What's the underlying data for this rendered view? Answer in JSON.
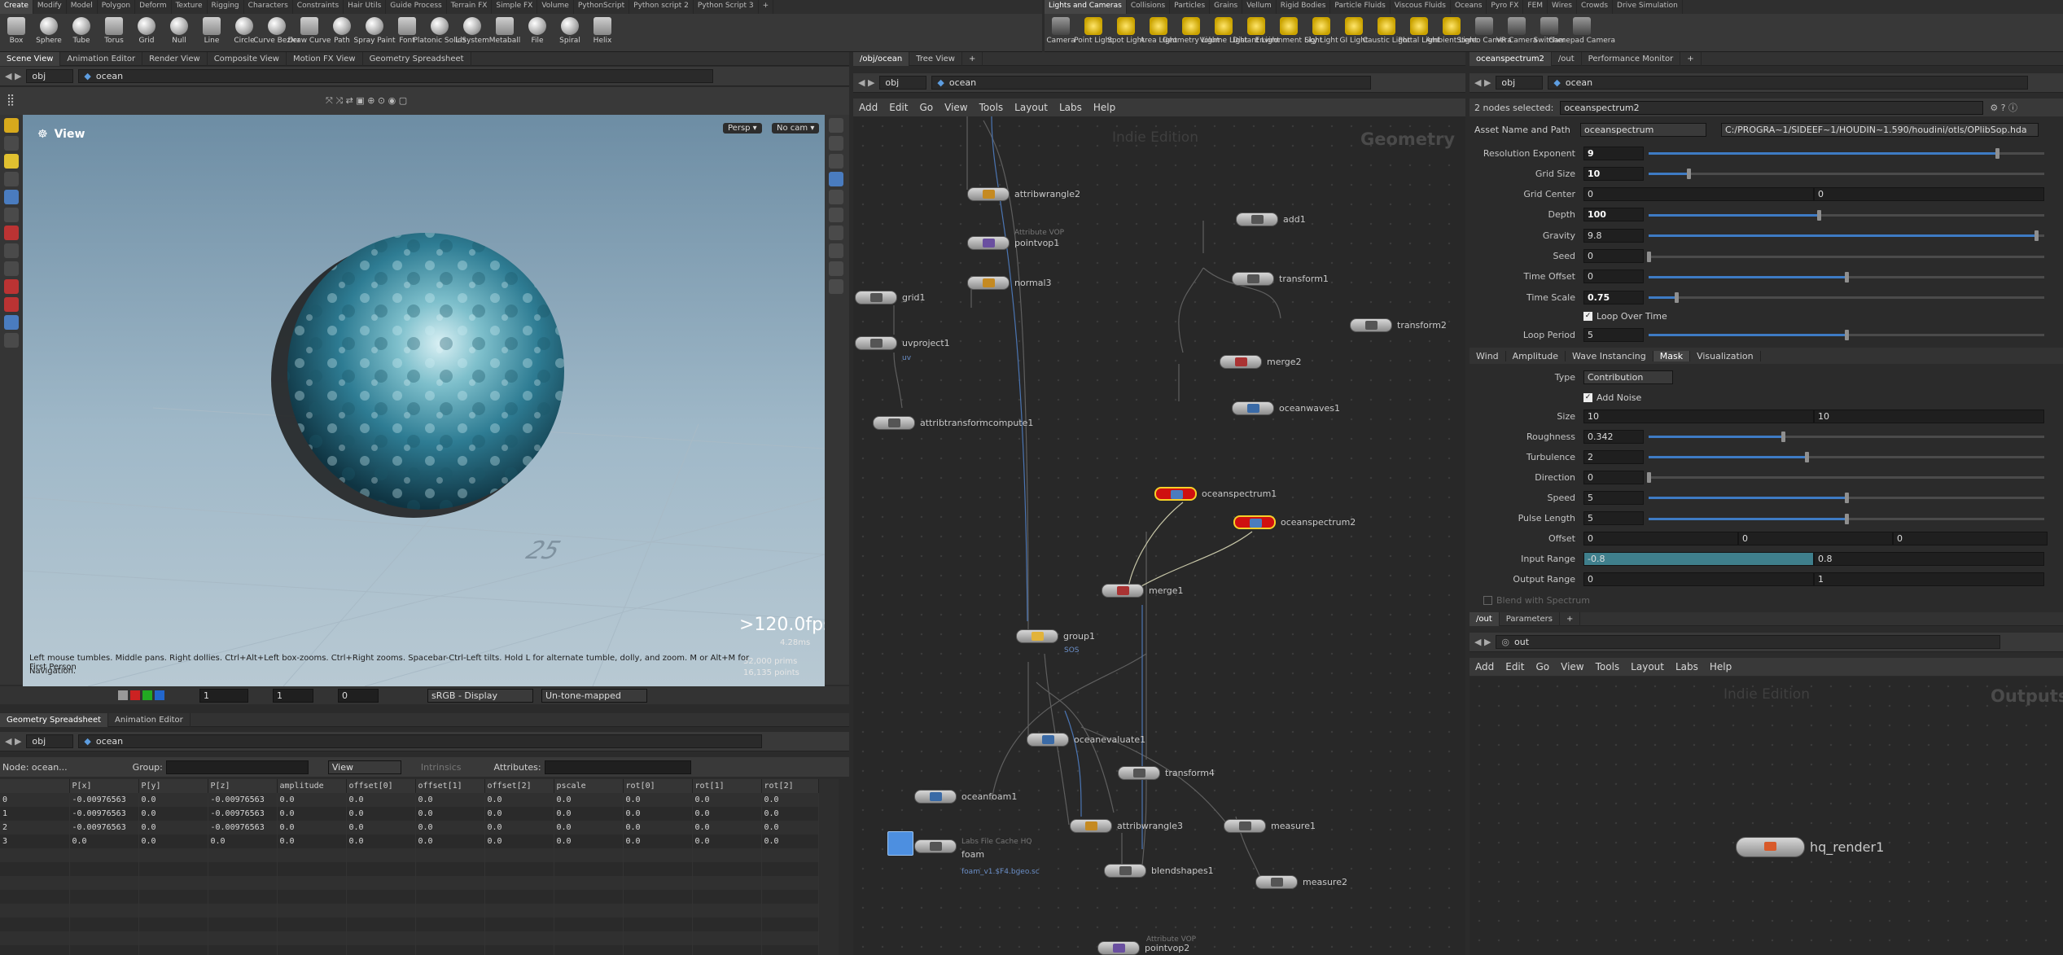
{
  "shelf_left": {
    "tabs": [
      "Create",
      "Modify",
      "Model",
      "Polygon",
      "Deform",
      "Texture",
      "Rigging",
      "Characters",
      "Constraints",
      "Hair Utils",
      "Guide Process",
      "Terrain FX",
      "Simple FX",
      "Volume",
      "PythonScript",
      "Python script 2",
      "Python Script 3",
      "+"
    ],
    "tools": [
      "Box",
      "Sphere",
      "Tube",
      "Torus",
      "Grid",
      "Null",
      "Line",
      "Circle",
      "Curve Bezier",
      "Draw Curve",
      "Path",
      "Spray Paint",
      "Font",
      "Platonic Solids",
      "L-System",
      "Metaball",
      "File",
      "Spiral",
      "Helix"
    ]
  },
  "shelf_right": {
    "tabs": [
      "Lights and Cameras",
      "Collisions",
      "Particles",
      "Grains",
      "Vellum",
      "Rigid Bodies",
      "Particle Fluids",
      "Viscous Fluids",
      "Oceans",
      "Pyro FX",
      "FEM",
      "Wires",
      "Crowds",
      "Drive Simulation"
    ],
    "tools": [
      "Camera",
      "Point Light",
      "Spot Light",
      "Area Light",
      "Geometry Light",
      "Volume Light",
      "Distant Light",
      "Environment Light",
      "Sky Light",
      "GI Light",
      "Caustic Light",
      "Portal Light",
      "Ambient Light",
      "Stereo Camera",
      "VR Camera",
      "Switcher",
      "Gamepad Camera"
    ]
  },
  "viewer": {
    "tabs": [
      "Scene View",
      "Animation Editor",
      "Render View",
      "Composite View",
      "Motion FX View",
      "Geometry Spreadsheet"
    ],
    "path": [
      "obj",
      "ocean"
    ],
    "title": "View",
    "persp": "Persp ▾",
    "cam": "No cam ▾",
    "fps": ">120.0fps",
    "ms": "4.28ms",
    "prims": "32,000  prims",
    "points": "16,135  points",
    "grid_number": "25",
    "help": "Left mouse tumbles. Middle pans. Right dollies. Ctrl+Alt+Left box-zooms. Ctrl+Right zooms. Spacebar-Ctrl-Left tilts. Hold L for alternate tumble, dolly, and zoom. M or Alt+M for First Person",
    "help2": "Navigation.",
    "bottom": {
      "frame1": "1",
      "frame2": "1",
      "frame3": "0",
      "display": "sRGB - Display",
      "tonemap": "Un-tone-mapped"
    }
  },
  "spreadsheet": {
    "tabs": [
      "Geometry Spreadsheet",
      "Animation Editor"
    ],
    "path": [
      "obj",
      "ocean"
    ],
    "node": "Node: ocean...",
    "group_label": "Group:",
    "view": "View",
    "intrinsics": "Intrinsics",
    "attributes_label": "Attributes:",
    "columns": [
      "",
      "P[x]",
      "P[y]",
      "P[z]",
      "amplitude",
      "offset[0]",
      "offset[1]",
      "offset[2]",
      "pscale",
      "rot[0]",
      "rot[1]",
      "rot[2]"
    ],
    "rows": [
      [
        "0",
        "-0.00976563",
        "0.0",
        "-0.00976563",
        "0.0",
        "0.0",
        "0.0",
        "0.0",
        "0.0",
        "0.0",
        "0.0",
        "0.0"
      ],
      [
        "1",
        "-0.00976563",
        "0.0",
        "-0.00976563",
        "0.0",
        "0.0",
        "0.0",
        "0.0",
        "0.0",
        "0.0",
        "0.0",
        "0.0"
      ],
      [
        "2",
        "-0.00976563",
        "0.0",
        "-0.00976563",
        "0.0",
        "0.0",
        "0.0",
        "0.0",
        "0.0",
        "0.0",
        "0.0",
        "0.0"
      ],
      [
        "3",
        "0.0",
        "0.0",
        "0.0",
        "0.0",
        "0.0",
        "0.0",
        "0.0",
        "0.0",
        "0.0",
        "0.0",
        "0.0"
      ]
    ]
  },
  "network": {
    "tabs": [
      "/obj/ocean",
      "Tree View",
      "+"
    ],
    "path": [
      "obj",
      "ocean"
    ],
    "menu": [
      "Add",
      "Edit",
      "Go",
      "View",
      "Tools",
      "Layout",
      "Labs",
      "Help"
    ],
    "watermark": "Indie Edition",
    "context": "Geometry",
    "nodes": [
      {
        "name": "attribwrangle2",
        "sub": ""
      },
      {
        "name": "pointvop1",
        "sub": "Attribute VOP"
      },
      {
        "name": "normal3",
        "sub": ""
      },
      {
        "name": "grid1",
        "sub": ""
      },
      {
        "name": "uvproject1",
        "sub": "uv"
      },
      {
        "name": "attribtransformcompute1",
        "sub": ""
      },
      {
        "name": "add1",
        "sub": ""
      },
      {
        "name": "transform1",
        "sub": ""
      },
      {
        "name": "transform2",
        "sub": ""
      },
      {
        "name": "merge2",
        "sub": ""
      },
      {
        "name": "oceanwaves1",
        "sub": ""
      },
      {
        "name": "oceanspectrum1",
        "sub": ""
      },
      {
        "name": "oceanspectrum2",
        "sub": ""
      },
      {
        "name": "merge1",
        "sub": ""
      },
      {
        "name": "group1",
        "sub": "SOS"
      },
      {
        "name": "oceanevaluate1",
        "sub": ""
      },
      {
        "name": "transform4",
        "sub": ""
      },
      {
        "name": "oceanfoam1",
        "sub": ""
      },
      {
        "name": "foam",
        "sub": "Labs File Cache HQ"
      },
      {
        "name": "attribwrangle3",
        "sub": ""
      },
      {
        "name": "measure1",
        "sub": ""
      },
      {
        "name": "blendshapes1",
        "sub": ""
      },
      {
        "name": "measure2",
        "sub": ""
      },
      {
        "name": "pointvop2",
        "sub": "Attribute VOP"
      }
    ],
    "foam_file": "foam_v1.$F4.bgeo.sc"
  },
  "params": {
    "tabs": [
      "oceanspectrum2",
      "/out",
      "Performance Monitor",
      "+"
    ],
    "path": [
      "obj",
      "ocean"
    ],
    "selected_label": "2 nodes selected:",
    "selected_value": "oceanspectrum2",
    "asset_label": "Asset Name and Path",
    "asset_name": "oceanspectrum",
    "asset_path": "C:/PROGRA~1/SIDEEF~1/HOUDIN~1.590/houdini/otls/OPlibSop.hda",
    "top": [
      {
        "label": "Resolution Exponent",
        "value": "9",
        "bold": true,
        "pct": 0.88
      },
      {
        "label": "Grid Size",
        "value": "10",
        "bold": true,
        "pct": 0.1
      },
      {
        "label": "Grid Center",
        "value": "0",
        "value2": "0"
      },
      {
        "label": "Depth",
        "value": "100",
        "bold": true,
        "pct": 0.43
      },
      {
        "label": "Gravity",
        "value": "9.8",
        "pct": 0.98
      },
      {
        "label": "Seed",
        "value": "0",
        "pct": 0.0
      },
      {
        "label": "Time Offset",
        "value": "0",
        "pct": 0.5
      },
      {
        "label": "Time Scale",
        "value": "0.75",
        "bold": true,
        "pct": 0.07
      }
    ],
    "loop_over_time": "Loop Over Time",
    "loop_period": {
      "label": "Loop Period",
      "value": "5",
      "pct": 0.5
    },
    "subtabs": [
      "Wind",
      "Amplitude",
      "Wave Instancing",
      "Mask",
      "Visualization"
    ],
    "type_label": "Type",
    "type_value": "Contribution",
    "add_noise": "Add Noise",
    "mask": [
      {
        "label": "Size",
        "value": "10",
        "value2": "10"
      },
      {
        "label": "Roughness",
        "value": "0.342",
        "pct": 0.34
      },
      {
        "label": "Turbulence",
        "value": "2",
        "pct": 0.4
      },
      {
        "label": "Direction",
        "value": "0",
        "pct": 0.0
      },
      {
        "label": "Speed",
        "value": "5",
        "pct": 0.5
      },
      {
        "label": "Pulse Length",
        "value": "5",
        "pct": 0.5
      },
      {
        "label": "Offset",
        "value": "0",
        "value2": "0",
        "value3": "0"
      },
      {
        "label": "Input Range",
        "value": "-0.8",
        "value2": "0.8"
      },
      {
        "label": "Output Range",
        "value": "0",
        "value2": "1"
      }
    ],
    "blend": "Blend with Spectrum"
  },
  "outnet": {
    "tabs": [
      "/out",
      "Parameters",
      "+"
    ],
    "path": [
      "out"
    ],
    "menu": [
      "Add",
      "Edit",
      "Go",
      "View",
      "Tools",
      "Layout",
      "Labs",
      "Help"
    ],
    "watermark": "Indie Edition",
    "context": "Outputs",
    "node": "hq_render1"
  }
}
